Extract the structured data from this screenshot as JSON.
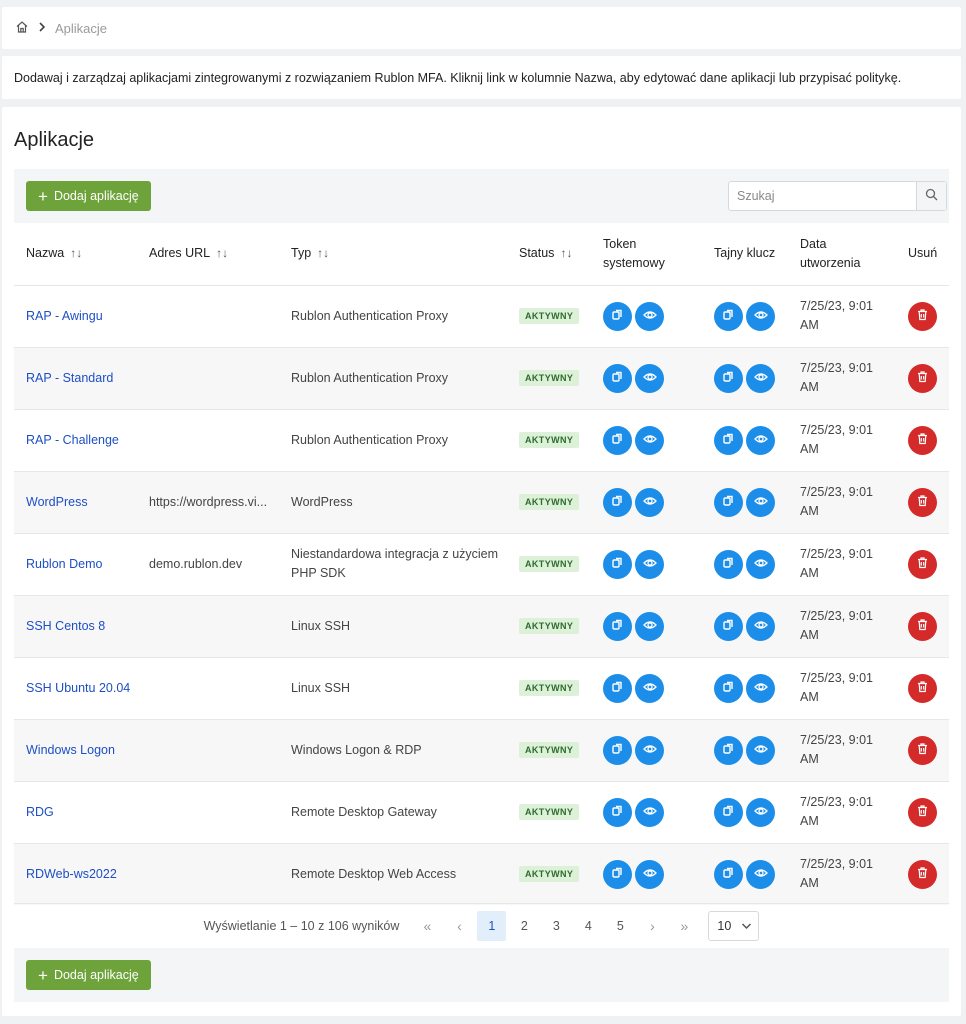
{
  "breadcrumb": {
    "current": "Aplikacje"
  },
  "intro": "Dodawaj i zarządzaj aplikacjami zintegrowanymi z rozwiązaniem Rublon MFA. Kliknij link w kolumnie Nazwa, aby edytować dane aplikacji lub przypisać politykę.",
  "page": {
    "title": "Aplikacje"
  },
  "toolbar": {
    "add_label": "Dodaj aplikację",
    "search_placeholder": "Szukaj"
  },
  "table": {
    "headers": {
      "name": "Nazwa",
      "url": "Adres URL",
      "type": "Typ",
      "status": "Status",
      "token_1": "Token",
      "token_2": "systemowy",
      "secret": "Tajny klucz",
      "date_1": "Data",
      "date_2": "utworzenia",
      "delete": "Usuń"
    },
    "rows": [
      {
        "name": "RAP - Awingu",
        "url": "",
        "type": "Rublon Authentication Proxy",
        "status": "AKTYWNY",
        "date_1": "7/25/23, 9:01",
        "date_2": "AM"
      },
      {
        "name": "RAP - Standard",
        "url": "",
        "type": "Rublon Authentication Proxy",
        "status": "AKTYWNY",
        "date_1": "7/25/23, 9:01",
        "date_2": "AM"
      },
      {
        "name": "RAP - Challenge",
        "url": "",
        "type": "Rublon Authentication Proxy",
        "status": "AKTYWNY",
        "date_1": "7/25/23, 9:01",
        "date_2": "AM"
      },
      {
        "name": "WordPress",
        "url": "https://wordpress.vi...",
        "type": "WordPress",
        "status": "AKTYWNY",
        "date_1": "7/25/23, 9:01",
        "date_2": "AM"
      },
      {
        "name": "Rublon Demo",
        "url": "demo.rublon.dev",
        "type": "Niestandardowa integracja z użyciem PHP SDK",
        "status": "AKTYWNY",
        "date_1": "7/25/23, 9:01",
        "date_2": "AM"
      },
      {
        "name": "SSH Centos 8",
        "url": "",
        "type": "Linux SSH",
        "status": "AKTYWNY",
        "date_1": "7/25/23, 9:01",
        "date_2": "AM"
      },
      {
        "name": "SSH Ubuntu 20.04",
        "url": "",
        "type": "Linux SSH",
        "status": "AKTYWNY",
        "date_1": "7/25/23, 9:01",
        "date_2": "AM"
      },
      {
        "name": "Windows Logon",
        "url": "",
        "type": "Windows Logon & RDP",
        "status": "AKTYWNY",
        "date_1": "7/25/23, 9:01",
        "date_2": "AM"
      },
      {
        "name": "RDG",
        "url": "",
        "type": "Remote Desktop Gateway",
        "status": "AKTYWNY",
        "date_1": "7/25/23, 9:01",
        "date_2": "AM"
      },
      {
        "name": "RDWeb-ws2022",
        "url": "",
        "type": "Remote Desktop Web Access",
        "status": "AKTYWNY",
        "date_1": "7/25/23, 9:01",
        "date_2": "AM"
      }
    ]
  },
  "pagination": {
    "info": "Wyświetlanie 1 – 10 z 106 wyników",
    "first": "«",
    "prev": "‹",
    "pages": [
      "1",
      "2",
      "3",
      "4",
      "5"
    ],
    "next": "›",
    "last": "»",
    "page_size": "10"
  },
  "colors": {
    "accent_green": "#6da33a",
    "action_blue": "#1c8ee9",
    "delete_red": "#d42a2a",
    "link": "#1d4fc4"
  },
  "icons": {
    "home": "home-icon",
    "breadcrumb_sep": "chevron-right-icon",
    "search": "search-icon",
    "copy": "copy-icon",
    "view": "eye-icon",
    "delete": "trash-icon",
    "sort": "sort-icon",
    "dropdown": "chevron-down-icon"
  }
}
